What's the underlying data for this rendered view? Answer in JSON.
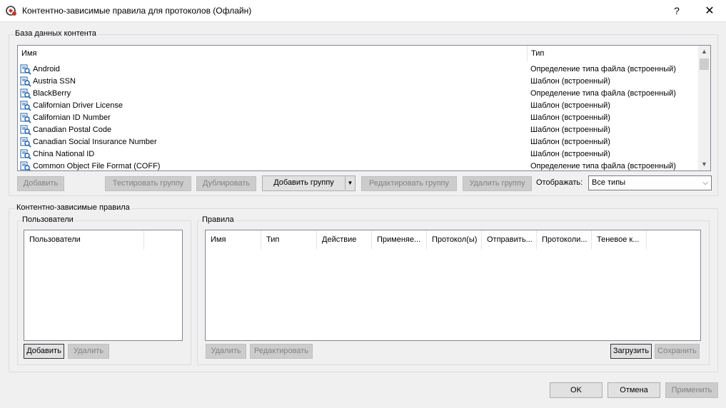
{
  "window": {
    "title": "Контентно-зависимые правила для протоколов (Офлайн)",
    "help": "?",
    "close": "✕"
  },
  "content_db": {
    "group_label": "База данных контента",
    "columns": [
      "Имя",
      "Тип"
    ],
    "rows": [
      {
        "name": "Android",
        "type": "Определение типа файла (встроенный)"
      },
      {
        "name": "Austria SSN",
        "type": "Шаблон (встроенный)"
      },
      {
        "name": "BlackBerry",
        "type": "Определение типа файла (встроенный)"
      },
      {
        "name": "Californian Driver License",
        "type": "Шаблон (встроенный)"
      },
      {
        "name": "Californian ID Number",
        "type": "Шаблон (встроенный)"
      },
      {
        "name": "Canadian Postal Code",
        "type": "Шаблон (встроенный)"
      },
      {
        "name": "Canadian Social Insurance Number",
        "type": "Шаблон (встроенный)"
      },
      {
        "name": "China National ID",
        "type": "Шаблон (встроенный)"
      },
      {
        "name": "Common Object File Format (COFF)",
        "type": "Определение типа файла (встроенный)"
      }
    ],
    "buttons": {
      "add": "Добавить",
      "test_group": "Тестировать группу",
      "duplicate": "Дублировать",
      "add_group": "Добавить группу",
      "edit_group": "Редактировать группу",
      "delete_group": "Удалить группу"
    },
    "display_label": "Отображать:",
    "display_value": "Все типы"
  },
  "rules_section": {
    "group_label": "Контентно-зависимые правила",
    "users": {
      "group_label": "Пользователи",
      "column": "Пользователи",
      "add": "Добавить",
      "delete": "Удалить"
    },
    "rules": {
      "group_label": "Правила",
      "columns": [
        "Имя",
        "Тип",
        "Действие",
        "Применяе...",
        "Протокол(ы)",
        "Отправить...",
        "Протоколи...",
        "Теневое к..."
      ],
      "delete": "Удалить",
      "edit": "Редактировать",
      "load": "Загрузить",
      "save": "Сохранить"
    }
  },
  "footer": {
    "ok": "OK",
    "cancel": "Отмена",
    "apply": "Применить"
  },
  "icons": {
    "app": "app-shield-icon",
    "row": "content-search-icon"
  }
}
